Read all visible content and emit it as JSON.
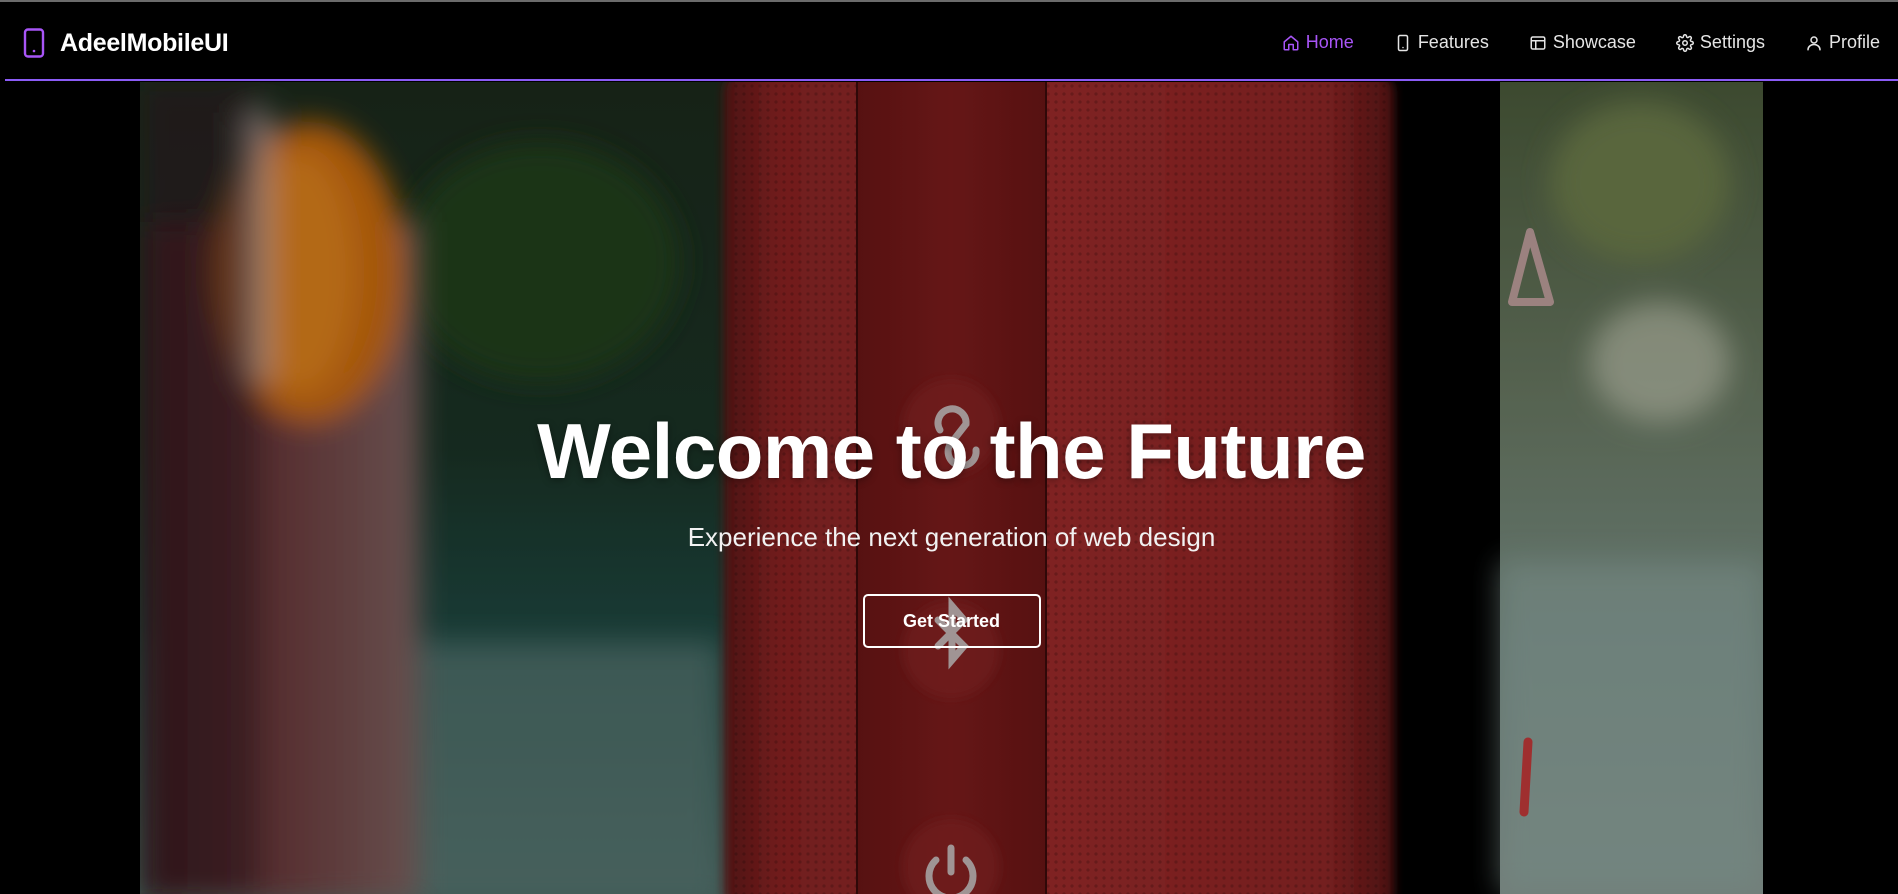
{
  "brand": {
    "name": "AdeelMobileUI",
    "icon": "smartphone-icon"
  },
  "nav": {
    "items": [
      {
        "label": "Home",
        "icon": "home-icon",
        "active": true
      },
      {
        "label": "Features",
        "icon": "smartphone-icon",
        "active": false
      },
      {
        "label": "Showcase",
        "icon": "layout-icon",
        "active": false
      },
      {
        "label": "Settings",
        "icon": "gear-icon",
        "active": false
      },
      {
        "label": "Profile",
        "icon": "user-icon",
        "active": false
      }
    ]
  },
  "hero": {
    "title": "Welcome to the Future",
    "subtitle": "Experience the next generation of web design",
    "cta_label": "Get Started"
  },
  "colors": {
    "accent": "#a855f7",
    "nav_underline": "#8b5cf6",
    "background": "#000000",
    "speaker_red": "#9b2a2a"
  }
}
